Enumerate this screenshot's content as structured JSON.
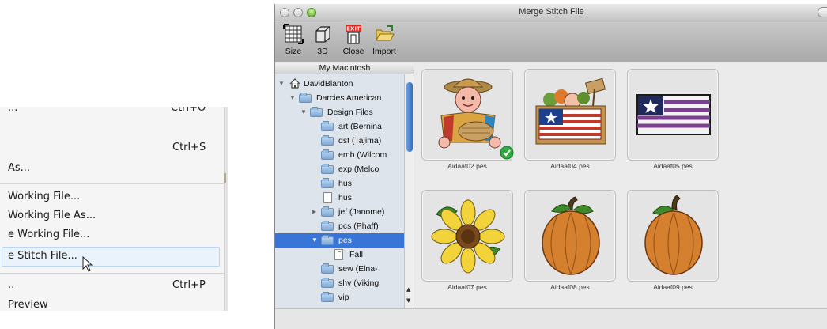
{
  "left_menu": {
    "items": [
      {
        "label": "...",
        "shortcut": "Ctrl+O"
      },
      {
        "label": "",
        "shortcut": "Ctrl+S"
      },
      {
        "label": "As...",
        "shortcut": ""
      },
      {
        "label": "Working File...",
        "shortcut": ""
      },
      {
        "label": "Working File As...",
        "shortcut": ""
      },
      {
        "label": "e Working File...",
        "shortcut": ""
      },
      {
        "label": "e Stitch File...",
        "shortcut": ""
      },
      {
        "label": "..",
        "shortcut": "Ctrl+P"
      },
      {
        "label": "Preview",
        "shortcut": ""
      }
    ]
  },
  "window": {
    "title": "Merge Stitch File",
    "toolbar": [
      {
        "label": "Size",
        "icon": "size-grid-icon"
      },
      {
        "label": "3D",
        "icon": "3d-cube-icon"
      },
      {
        "label": "Close",
        "icon": "exit-door-icon",
        "badge": "EXIT"
      },
      {
        "label": "Import",
        "icon": "open-folder-icon"
      }
    ],
    "sidebar": {
      "header": "My Macintosh",
      "tree": [
        {
          "label": "DavidBlanton",
          "level": 0,
          "type": "home",
          "expanded": true
        },
        {
          "label": "Darcies American",
          "level": 1,
          "type": "folder",
          "expanded": true
        },
        {
          "label": "Design Files",
          "level": 2,
          "type": "folder",
          "expanded": true
        },
        {
          "label": "art (Bernina",
          "level": 3,
          "type": "folder"
        },
        {
          "label": "dst (Tajima)",
          "level": 3,
          "type": "folder"
        },
        {
          "label": "emb (Wilcom",
          "level": 3,
          "type": "folder"
        },
        {
          "label": "exp (Melco",
          "level": 3,
          "type": "folder"
        },
        {
          "label": "hus",
          "level": 3,
          "type": "folder"
        },
        {
          "label": "hus",
          "level": 3,
          "type": "doc"
        },
        {
          "label": "jef (Janome)",
          "level": 3,
          "type": "folder",
          "collapsed": true
        },
        {
          "label": "pcs (Phaff)",
          "level": 3,
          "type": "folder"
        },
        {
          "label": "pes",
          "level": 3,
          "type": "folder",
          "expanded": true,
          "selected": true
        },
        {
          "label": "Fall",
          "level": 4,
          "type": "doc"
        },
        {
          "label": "sew (Elna-",
          "level": 3,
          "type": "folder"
        },
        {
          "label": "shv (Viking",
          "level": 3,
          "type": "folder"
        },
        {
          "label": "vip",
          "level": 3,
          "type": "folder"
        }
      ]
    },
    "files": [
      {
        "name": "Aidaaf02.pes",
        "design": "scarecrow",
        "checked": true
      },
      {
        "name": "Aidaaf04.pes",
        "design": "flag-basket"
      },
      {
        "name": "Aidaaf05.pes",
        "design": "flag"
      },
      {
        "name": "Aidaaf07.pes",
        "design": "sunflower"
      },
      {
        "name": "Aidaaf08.pes",
        "design": "pumpkin"
      },
      {
        "name": "Aidaaf09.pes",
        "design": "pumpkin"
      }
    ],
    "colors": {
      "selection": "#3875d7",
      "check": "#2eaa3f",
      "pumpkin": "#d4802f"
    }
  }
}
